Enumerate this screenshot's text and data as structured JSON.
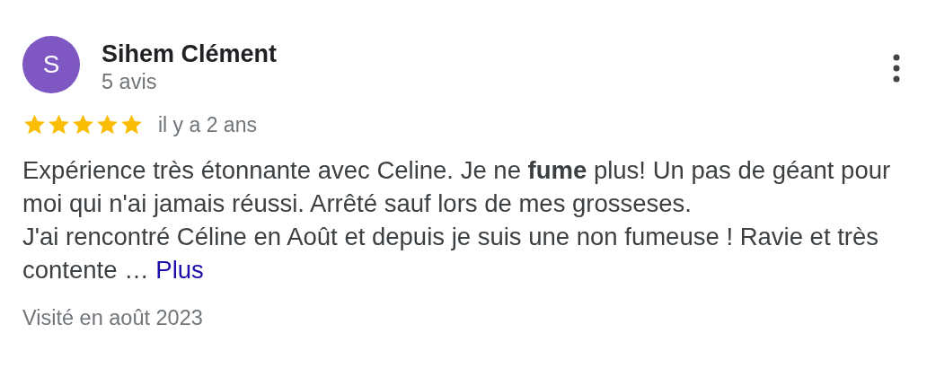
{
  "reviewer": {
    "initial": "S",
    "color": "#7e57c2",
    "name": "Sihem Clément",
    "review_count": "5 avis"
  },
  "review": {
    "stars": 5,
    "time": "il y a 2 ans",
    "text": "Expérience très étonnante avec Celine. Je ne **fume** plus! Un pas de géant pour moi qui n'ai jamais réussi. Arrêté sauf lors de mes grosseses.\nJ'ai rencontré Céline en Août et depuis je suis une non fumeuse ! Ravie et très contente …",
    "more_link": "Plus",
    "visited": "Visité en août 2023"
  }
}
